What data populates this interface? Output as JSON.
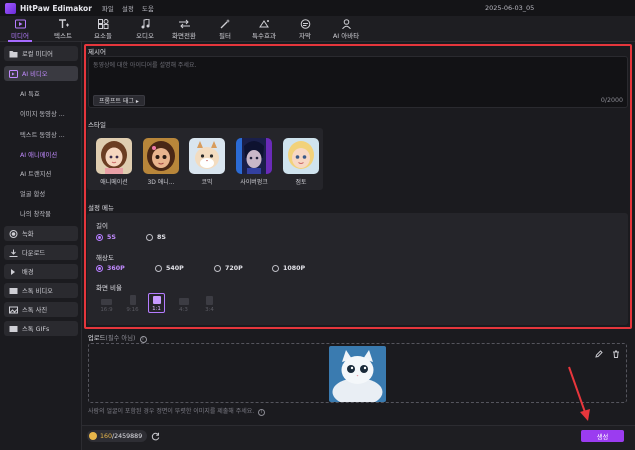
{
  "titlebar": {
    "app_name": "HitPaw Edimakor",
    "menus": [
      "파일",
      "설정",
      "도움"
    ],
    "project": "2025-06-03_05"
  },
  "toolbar": {
    "tabs": [
      "미디어",
      "텍스트",
      "요소들",
      "오디오",
      "화면전환",
      "필터",
      "특수효과",
      "자막",
      "AI 아바타"
    ],
    "active": "미디어"
  },
  "sidebar": {
    "items": [
      {
        "label": "로컬 미디어",
        "type": "group",
        "icon": "folder-icon"
      },
      {
        "label": "AI 비디오",
        "type": "group-selected",
        "icon": "ai-icon"
      },
      {
        "label": "AI 특효",
        "type": "sub"
      },
      {
        "label": "이미지 동영상 ...",
        "type": "sub"
      },
      {
        "label": "텍스트 동영상 ...",
        "type": "sub"
      },
      {
        "label": "AI 애니메이션",
        "type": "sub-highlight"
      },
      {
        "label": "AI 트랜지션",
        "type": "sub"
      },
      {
        "label": "얼굴 합성",
        "type": "sub"
      },
      {
        "label": "나의 창작물",
        "type": "sub"
      },
      {
        "label": "녹화",
        "type": "group",
        "icon": "record-icon"
      },
      {
        "label": "다운로드",
        "type": "group",
        "icon": "download-icon"
      },
      {
        "label": "배경",
        "type": "group",
        "icon": "background-icon"
      },
      {
        "label": "스톡 비디오",
        "type": "group",
        "icon": "stock-video-icon"
      },
      {
        "label": "스톡 사진",
        "type": "group",
        "icon": "stock-photo-icon"
      },
      {
        "label": "스톡 GIFs",
        "type": "group",
        "icon": "gif-icon"
      }
    ]
  },
  "prompt": {
    "title": "제시어",
    "placeholder": "동영상에 대한 아이디어를 설명해 주세요.",
    "tag_label": "프롬프트 태그 ▸",
    "counter": "0/2000"
  },
  "style": {
    "title": "스타일",
    "cards": [
      {
        "label": "애니메이션"
      },
      {
        "label": "3D 애니..."
      },
      {
        "label": "코믹"
      },
      {
        "label": "사이버펑크"
      },
      {
        "label": "점토"
      }
    ]
  },
  "settings": {
    "title": "설정 메뉴",
    "length": {
      "label": "길이",
      "options": [
        "5S",
        "8S"
      ],
      "selected": "5S"
    },
    "resolution": {
      "label": "해상도",
      "options": [
        "360P",
        "540P",
        "720P",
        "1080P"
      ],
      "selected": "360P"
    },
    "ratio": {
      "label": "화면 비율",
      "options": [
        "16:9",
        "9:16",
        "1:1",
        "4:3",
        "3:4"
      ],
      "selected": "1:1"
    }
  },
  "upload": {
    "title": "업로드",
    "optional": "(필수 아님)",
    "hint": "사람의 얼굴이 포함된 경우 정면이 뚜렷한 이미지를 제출해 주세요."
  },
  "footer": {
    "credits_used": "160",
    "credits_total": "/2459889",
    "generate_label": "생성"
  }
}
